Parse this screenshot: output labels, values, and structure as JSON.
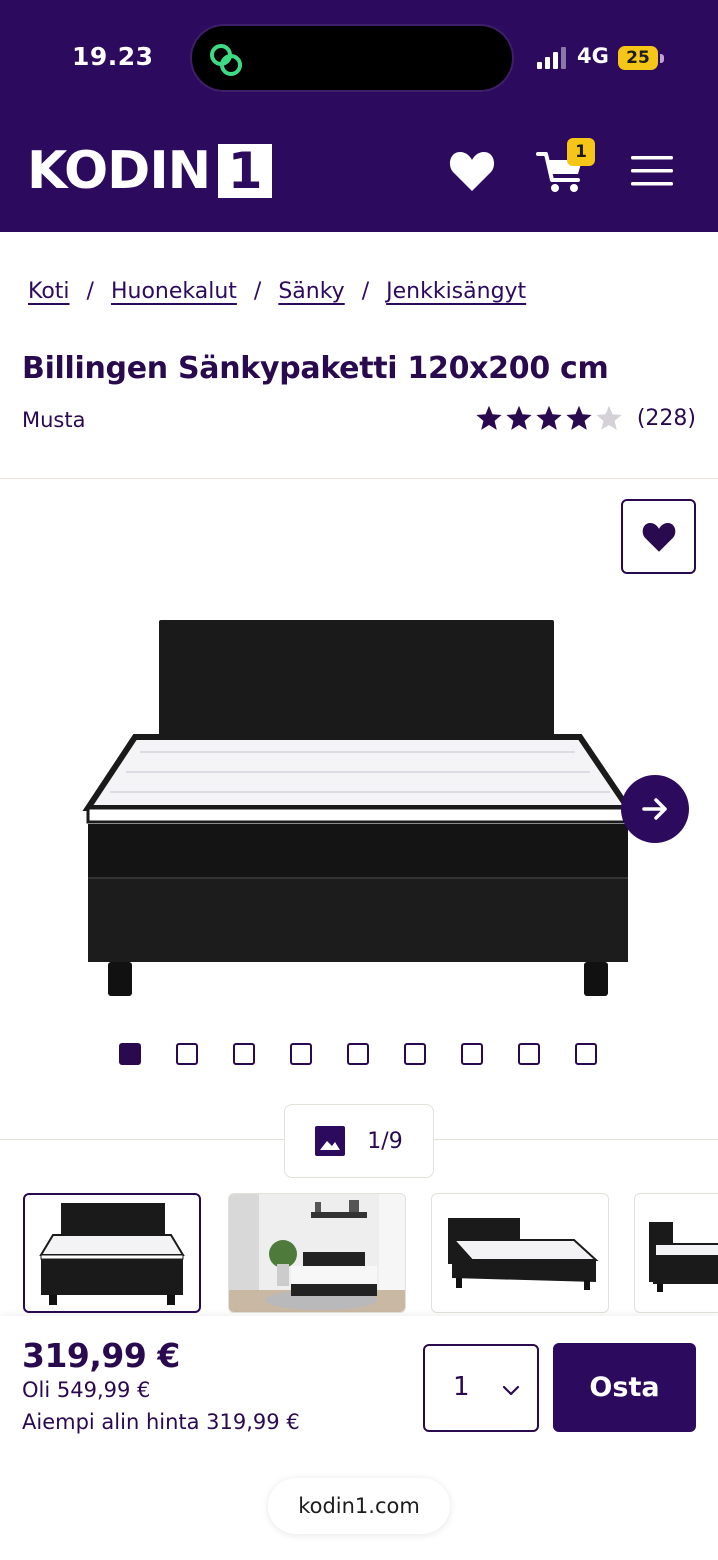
{
  "status_bar": {
    "time": "19.23",
    "network": "4G",
    "battery": "25"
  },
  "header": {
    "brand": "KODIN",
    "brand_mark": "1",
    "cart_count": "1"
  },
  "breadcrumb": [
    "Koti",
    "Huonekalut",
    "Sänky",
    "Jenkkisängyt"
  ],
  "breadcrumb_separator": "/",
  "product": {
    "title": "Billingen Sänkypaketti 120x200 cm",
    "variant": "Musta",
    "rating": 4,
    "rating_max": 5,
    "review_count": "(228)"
  },
  "gallery": {
    "image_count": 9,
    "active_index": 0,
    "counter": "1/9"
  },
  "purchase": {
    "price": "319,99 €",
    "old_price": "Oli 549,99 €",
    "lowest_price": "Aiempi alin hinta 319,99 €",
    "quantity": "1",
    "buy_label": "Osta"
  },
  "browser": {
    "url": "kodin1.com"
  },
  "colors": {
    "brand": "#2c0a5e",
    "badge": "#f5c518",
    "text": "#2a0a4f"
  },
  "icons": [
    "chat-link-icon",
    "signal-icon",
    "heart-icon",
    "cart-icon",
    "menu-icon",
    "arrow-right-icon",
    "image-icon",
    "chevron-down-icon",
    "star-icon"
  ]
}
